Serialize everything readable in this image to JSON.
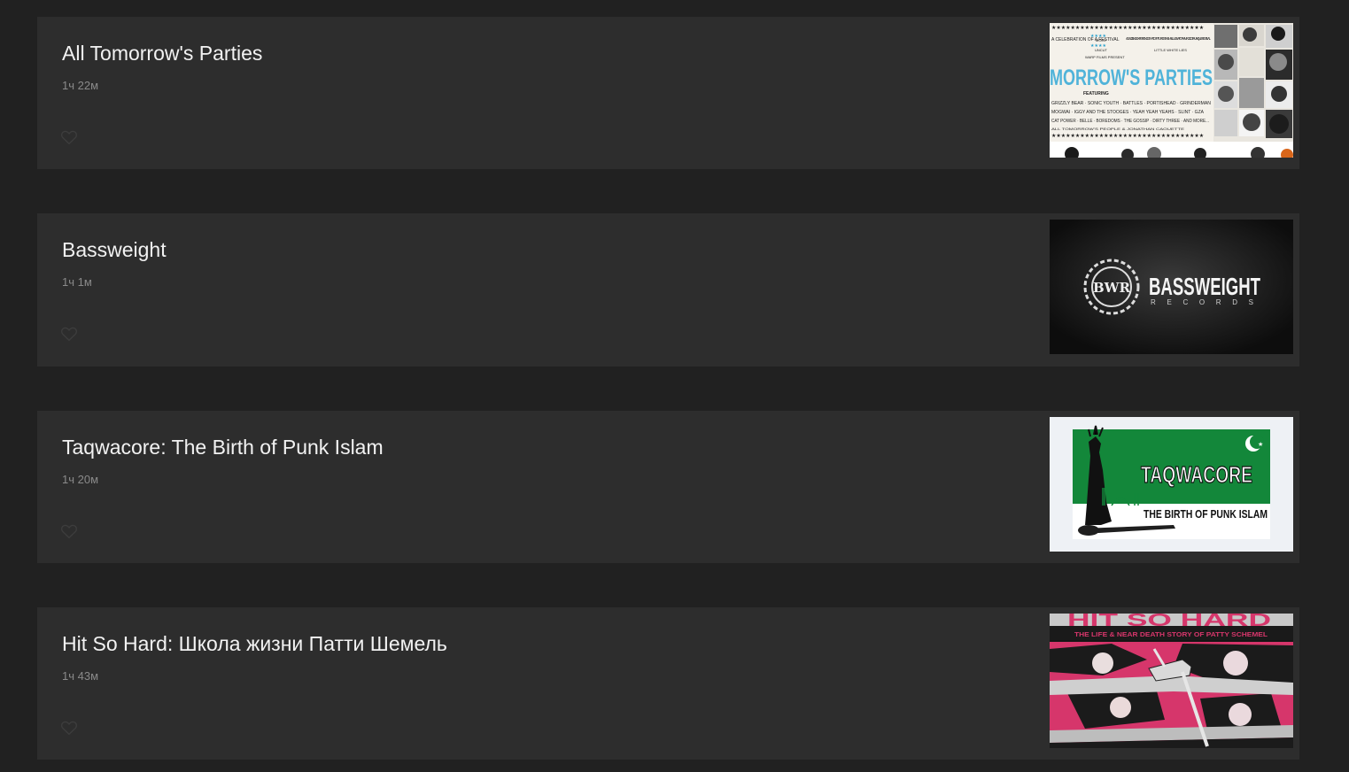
{
  "films": [
    {
      "title": "All Tomorrow's Parties",
      "duration": "1ч 22м",
      "poster": {
        "main_text": "MORROW'S PARTIES",
        "featuring": "FEATURING",
        "left_quote": "A CELEBRATION OF A FESTIVAL",
        "right_quote": "A DAZZLING EXPERIENCE THAT CAPTURES THE HALLUCINATORY MAGIC OF A UNIQUE FESTIVAL",
        "right_source": "LITTLE WHITE LIES",
        "mojo": "MOJO",
        "uncut": "UNCUT",
        "presents": "WARP FILMS PRESENT",
        "bands_1": "GRIZZLY BEAR · SONIC YOUTH · BATTLES · PORTISHEAD · GRINDERMAN",
        "bands_2": "MOGWAI · IGGY AND THE STOOGES · YEAH YEAH YEAHS · SLINT · GZA",
        "bands_3": "CAT POWER · BELLE · BOREDOMS · THE GOSSIP · DIRTY THREE · AND MORE...",
        "credit": "ALL TOMORROW'S PEOPLE & JONATHAN CAOUETTE",
        "text_color": "#4fb3d9"
      }
    },
    {
      "title": "Bassweight",
      "duration": "1ч 1м",
      "poster": {
        "main_text": "BASSWEIGHT",
        "sub_text": "RECORDS",
        "emblem": "BWR"
      }
    },
    {
      "title": "Taqwacore: The Birth of Punk Islam",
      "duration": "1ч 20м",
      "poster": {
        "main_text": "TAQWACORE",
        "sub_text": "THE BIRTH OF PUNK ISLAM",
        "green": "#13873a"
      }
    },
    {
      "title": "Hit So Hard: Школа жизни Патти Шемель",
      "duration": "1ч 43м",
      "poster": {
        "main_text": "HIT SO HARD",
        "sub_text": "THE LIFE & NEAR DEATH STORY OF PATTY SCHEMEL",
        "pink": "#d6366b"
      }
    }
  ],
  "icons": {
    "favorite": "heart-outline-icon"
  }
}
